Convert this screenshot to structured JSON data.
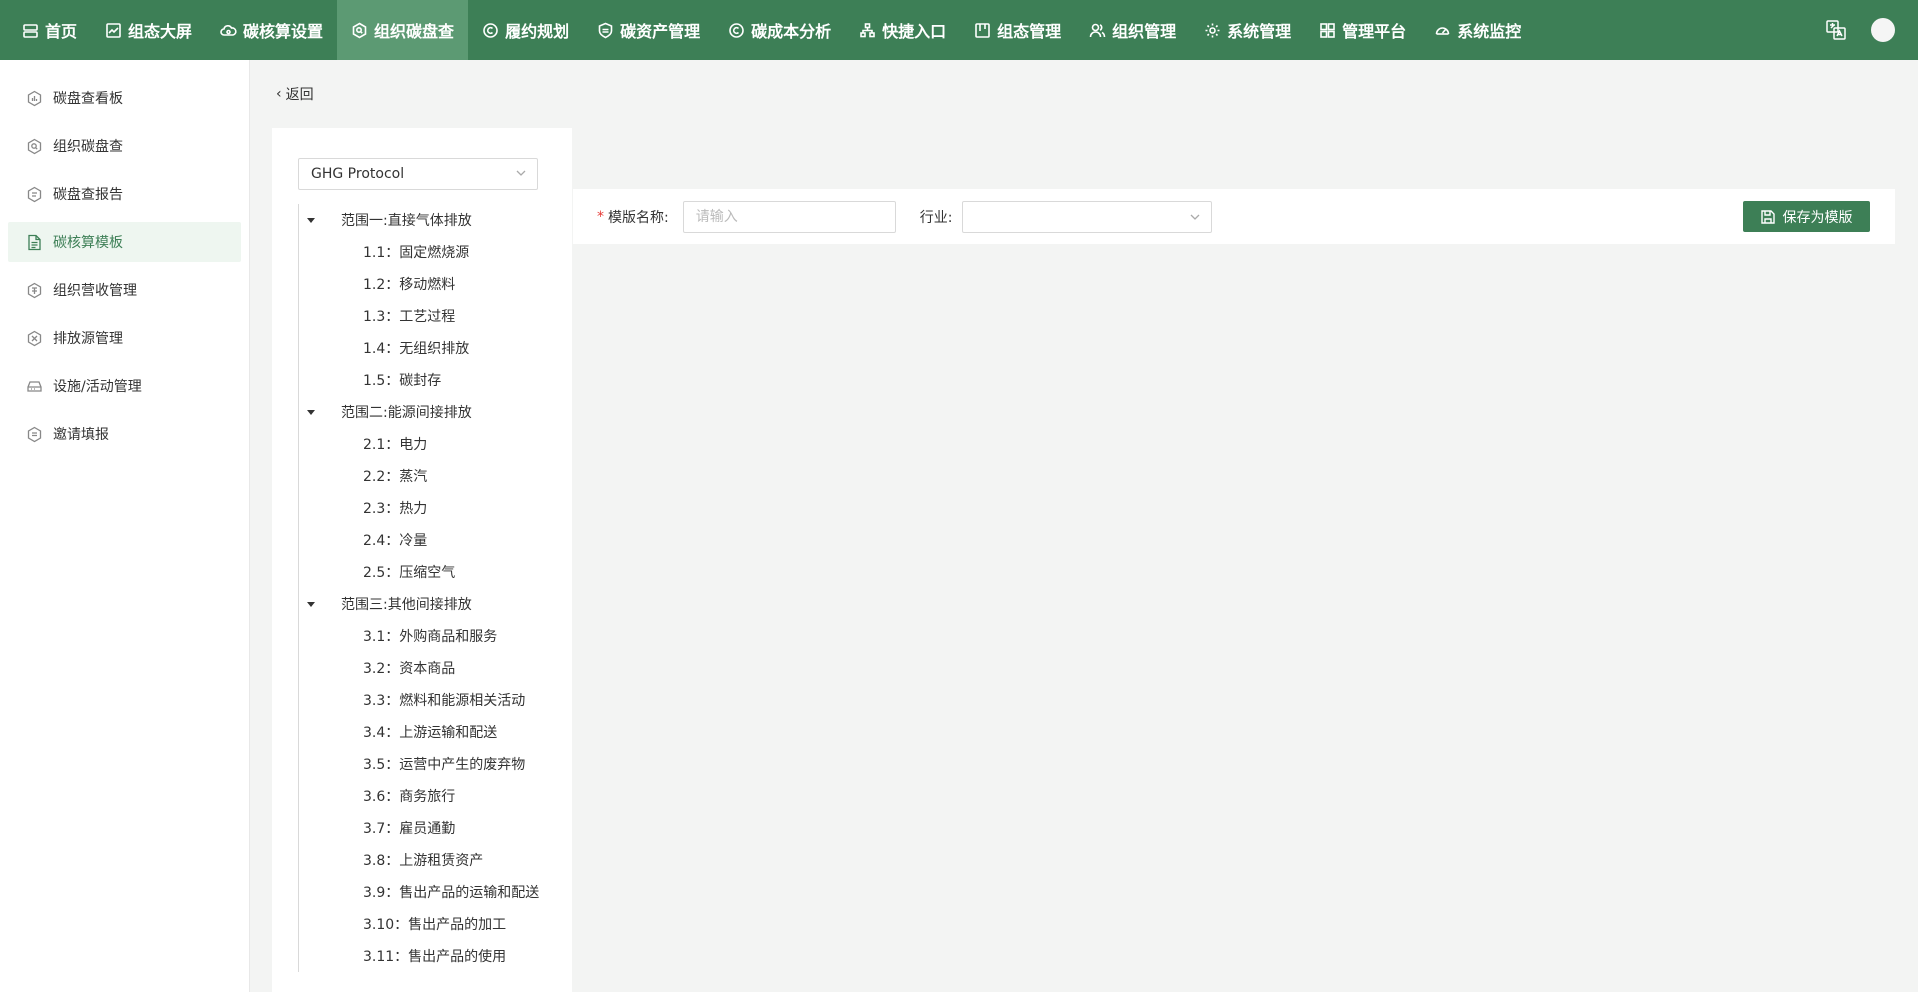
{
  "nav": {
    "items": [
      {
        "label": "首页",
        "icon": "server-icon"
      },
      {
        "label": "组态大屏",
        "icon": "chart-line-icon"
      },
      {
        "label": "碳核算设置",
        "icon": "cloud-settings-icon"
      },
      {
        "label": "组织碳盘查",
        "icon": "search-badge-icon",
        "active": true
      },
      {
        "label": "履约规划",
        "icon": "copyright-icon"
      },
      {
        "label": "碳资产管理",
        "icon": "shield-icon"
      },
      {
        "label": "碳成本分析",
        "icon": "copyright-icon"
      },
      {
        "label": "快捷入口",
        "icon": "sitemap-icon"
      },
      {
        "label": "组态管理",
        "icon": "board-icon"
      },
      {
        "label": "组织管理",
        "icon": "users-icon"
      },
      {
        "label": "系统管理",
        "icon": "gear-icon"
      },
      {
        "label": "管理平台",
        "icon": "grid-icon"
      },
      {
        "label": "系统监控",
        "icon": "dashboard-icon"
      }
    ]
  },
  "sidebar": {
    "items": [
      {
        "label": "碳盘查看板",
        "icon": "hex-chart-icon"
      },
      {
        "label": "组织碳盘查",
        "icon": "hex-search-icon"
      },
      {
        "label": "碳盘查报告",
        "icon": "hex-report-icon"
      },
      {
        "label": "碳核算模板",
        "icon": "document-icon",
        "active": true
      },
      {
        "label": "组织营收管理",
        "icon": "hex-money-icon"
      },
      {
        "label": "排放源管理",
        "icon": "hex-tools-icon"
      },
      {
        "label": "设施/活动管理",
        "icon": "storage-icon"
      },
      {
        "label": "邀请填报",
        "icon": "hex-list-icon"
      }
    ]
  },
  "back_label": "返回",
  "protocol_select": {
    "value": "GHG Protocol"
  },
  "tree": {
    "groups": [
      {
        "label": "范围一:直接气体排放",
        "children": [
          "1.1：固定燃烧源",
          "1.2：移动燃料",
          "1.3：工艺过程",
          "1.4：无组织排放",
          "1.5：碳封存"
        ]
      },
      {
        "label": "范围二:能源间接排放",
        "children": [
          "2.1：电力",
          "2.2：蒸汽",
          "2.3：热力",
          "2.4：冷量",
          "2.5：压缩空气"
        ]
      },
      {
        "label": "范围三:其他间接排放",
        "children": [
          "3.1：外购商品和服务",
          "3.2：资本商品",
          "3.3：燃料和能源相关活动",
          "3.4：上游运输和配送",
          "3.5：运营中产生的废弃物",
          "3.6：商务旅行",
          "3.7：雇员通勤",
          "3.8：上游租赁资产",
          "3.9：售出产品的运输和配送",
          "3.10：售出产品的加工",
          "3.11：售出产品的使用"
        ]
      }
    ]
  },
  "form": {
    "required_mark": "*",
    "name_label": "模版名称:",
    "name_placeholder": "请输入",
    "name_value": "",
    "industry_label": "行业:",
    "industry_value": "",
    "save_label": "保存为模版"
  }
}
